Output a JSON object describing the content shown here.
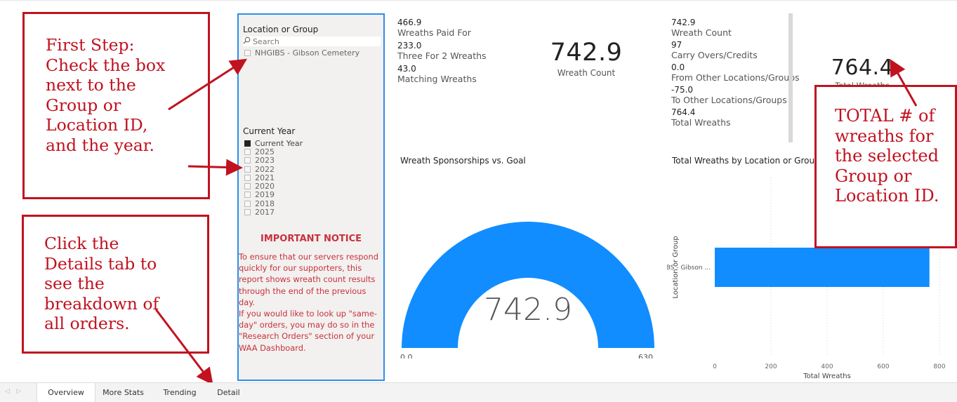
{
  "slicer": {
    "location_title": "Location or Group",
    "search_placeholder": "Search",
    "location_item": "NHGIBS - Gibson Cemetery",
    "year_title": "Current Year",
    "years": [
      "Current Year",
      "2025",
      "2023",
      "2022",
      "2021",
      "2020",
      "2019",
      "2018",
      "2017"
    ],
    "selected_year": "Current Year"
  },
  "notice": {
    "title": "IMPORTANT NOTICE",
    "lines": [
      "To ensure that our servers respond",
      "quickly for our supporters, this",
      "report shows wreath count results",
      "through the end of the previous day.",
      "If you would like to look up \"same-",
      "day\" orders, you may do so in the",
      "\"Research Orders\" section of your",
      "WAA Dashboard."
    ]
  },
  "kpis_left": [
    {
      "value": "466.9",
      "label": "Wreaths Paid For"
    },
    {
      "value": "233.0",
      "label": "Three For 2 Wreaths"
    },
    {
      "value": "43.0",
      "label": "Matching Wreaths"
    }
  ],
  "wreath_count_card": {
    "value": "742.9",
    "label": "Wreath Count"
  },
  "kpis_right": [
    {
      "value": "742.9",
      "label": "Wreath Count"
    },
    {
      "value": "97",
      "label": "Carry Overs/Credits"
    },
    {
      "value": "0.0",
      "label": "From Other Locations/Groups"
    },
    {
      "value": "-75.0",
      "label": "To Other Locations/Groups"
    },
    {
      "value": "764.4",
      "label": "Total Wreaths"
    }
  ],
  "total_card": {
    "value": "764.4",
    "label": "Total Wreaths"
  },
  "gauge": {
    "title": "Wreath Sponsorships vs. Goal",
    "value": 742.9,
    "value_label": "742.9",
    "min_label": "0.0",
    "max_label": "630",
    "color": "#118DFF"
  },
  "bar_chart_title": "Total Wreaths by Location or Group",
  "chart_data": {
    "type": "bar",
    "orientation": "horizontal",
    "categories": [
      "NHGIBS - Gibson ..."
    ],
    "values": [
      764.4
    ],
    "xlabel": "Total Wreaths",
    "ylabel": "Location or Group",
    "xlim": [
      0,
      800
    ],
    "xticks": [
      "0",
      "200",
      "400",
      "600",
      "800"
    ],
    "color": "#118DFF"
  },
  "annotations": {
    "first_step": [
      "First Step:",
      "Check the box",
      "next to the",
      "Group or",
      "Location ID,",
      "and the year."
    ],
    "details": [
      "Click the",
      "Details tab to",
      "see the",
      "breakdown of",
      "all orders."
    ],
    "total": [
      "TOTAL # of",
      "wreaths for",
      "the selected",
      "Group or",
      "Location  ID."
    ],
    "color": "#c1121f"
  },
  "tabs": [
    "Overview",
    "More Stats",
    "Trending",
    "Detail"
  ],
  "active_tab": "Overview"
}
